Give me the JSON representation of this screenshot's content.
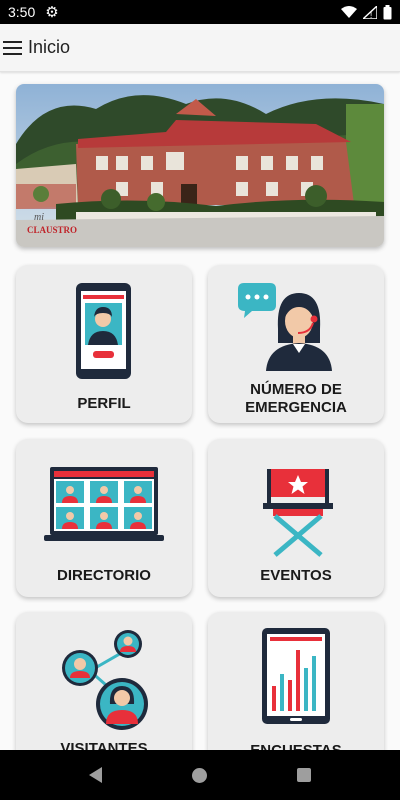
{
  "status_bar": {
    "time": "3:50"
  },
  "app_bar": {
    "title": "Inicio"
  },
  "banner": {
    "logo_small": "mi",
    "logo_text": "CLAUSTRO"
  },
  "cards": [
    {
      "label": "PERFIL"
    },
    {
      "label_line1": "NÚMERO DE",
      "label_line2": "EMERGENCIA"
    },
    {
      "label": "DIRECTORIO"
    },
    {
      "label": "EVENTOS"
    },
    {
      "label": "VISITANTES"
    },
    {
      "label": "ENCUESTAS"
    }
  ],
  "colors": {
    "accent_red": "#e8303a",
    "dark_navy": "#1f2a3c",
    "teal": "#3bb6c4"
  }
}
